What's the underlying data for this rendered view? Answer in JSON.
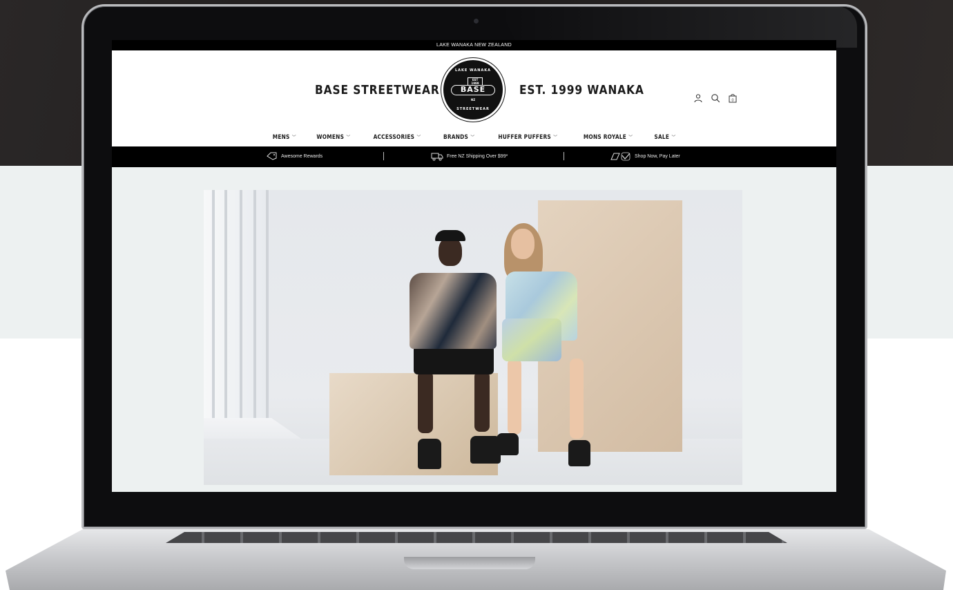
{
  "announcement": {
    "text": "LAKE WANAKA NEW ZEALAND"
  },
  "header": {
    "brand_left": "BASE STREETWEAR",
    "brand_right": "EST. 1999 WANAKA",
    "logo": {
      "top_text": "LAKE WANAKA",
      "est_text": "EST 1999",
      "word": "BASE",
      "nz_text": "NZ",
      "bottom_text": "STREETWEAR"
    },
    "icons": [
      "account-icon",
      "search-icon",
      "cart-icon"
    ],
    "cart_count": "0"
  },
  "nav": {
    "items": [
      {
        "label": "MENS"
      },
      {
        "label": "WOMENS"
      },
      {
        "label": "ACCESSORIES"
      },
      {
        "label": "BRANDS"
      },
      {
        "label": "HUFFER PUFFERS"
      },
      {
        "label": "MONS ROYALE"
      },
      {
        "label": "SALE"
      }
    ],
    "chevron": "﹀"
  },
  "usp_bar": {
    "rewards": "Awesome Rewards",
    "shipping": "Free NZ Shipping Over $99*",
    "pay_later": "Shop Now, Pay Later"
  },
  "colors": {
    "black": "#000000",
    "page_background": "#edf1f1",
    "text": "#1a1a1a"
  }
}
